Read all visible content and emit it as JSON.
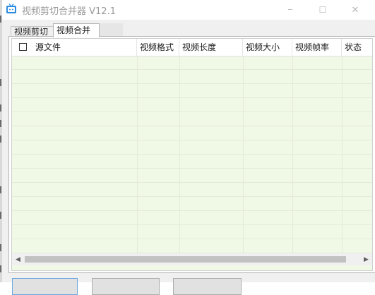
{
  "window": {
    "title": "视频剪切合并器 V12.1",
    "controls": {
      "minimize": "─",
      "maximize": "☐",
      "close": "✕"
    }
  },
  "tabs": [
    {
      "label": "视频剪切",
      "selected": false
    },
    {
      "label": "视频合并",
      "selected": true
    }
  ],
  "table": {
    "columns": [
      "源文件",
      "视频格式",
      "视频长度",
      "视频大小",
      "视频帧率",
      "状态"
    ],
    "select_all_checked": false,
    "rows": []
  },
  "colors": {
    "list_background": "#f0f8e6",
    "window_background": "#f0f0f0",
    "focus_border": "#6aa6de"
  },
  "icons": {
    "app": "tv-icon",
    "scroll_left": "arrow-left-icon",
    "scroll_right": "arrow-right-icon"
  }
}
